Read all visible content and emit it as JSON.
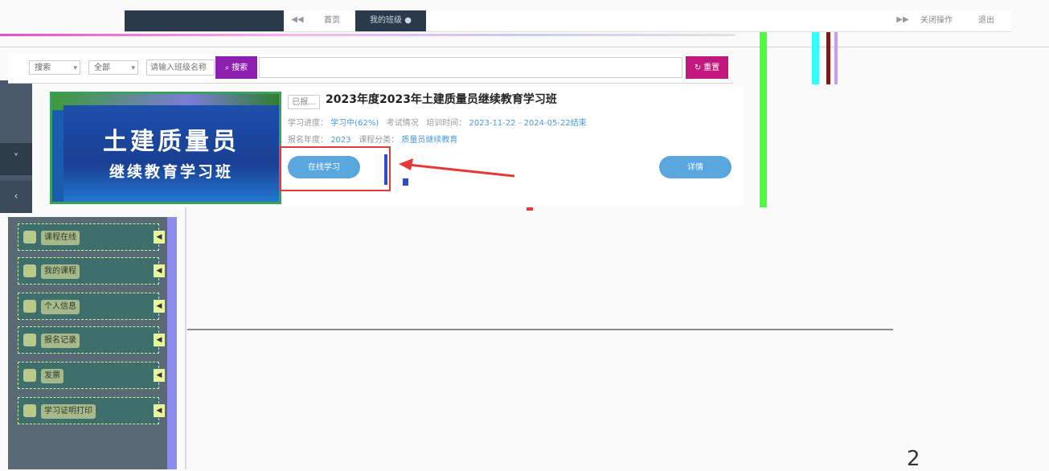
{
  "topbar": {
    "prev": "◀◀",
    "home_tab": "首页",
    "active_tab": "我的班级",
    "next": "▶▶",
    "close_ops": "关闭操作",
    "exit": "退出"
  },
  "sidebar_left": {
    "toggle_down": "˅",
    "toggle_left": "‹"
  },
  "search": {
    "select1": "搜索",
    "select2": "全部",
    "input_placeholder": "请输入班级名称",
    "search_label": "搜索",
    "reset_label": "重置"
  },
  "course": {
    "banner_line1": "土建质量员",
    "banner_line2": "继续教育学习班",
    "tag": "已报...",
    "title": "2023年度2023年土建质量员继续教育学习班",
    "meta1_label": "学习进度：",
    "meta1_status": "学习中(62%)",
    "meta1_exam": "考试情况",
    "meta1_period_label": "培训时间：",
    "meta1_start": "2023-11-22",
    "meta1_sep": " - ",
    "meta1_end": "2024-05-22结束",
    "meta2_label": "报名年度：",
    "meta2_year": "2023",
    "meta2_cat_label": "课程分类：",
    "meta2_cat": "质量员继续教育",
    "study_button": "在线学习",
    "detail_button": "详情"
  },
  "menu": [
    {
      "label": "课程在线",
      "badge": "◀"
    },
    {
      "label": "我的课程",
      "badge": "◀"
    },
    {
      "label": "个人信息",
      "badge": "◀"
    },
    {
      "label": "报名记录",
      "badge": "◀"
    },
    {
      "label": "发票",
      "badge": "◀"
    },
    {
      "label": "学习证明打印",
      "badge": "◀"
    }
  ],
  "page_number": "2"
}
